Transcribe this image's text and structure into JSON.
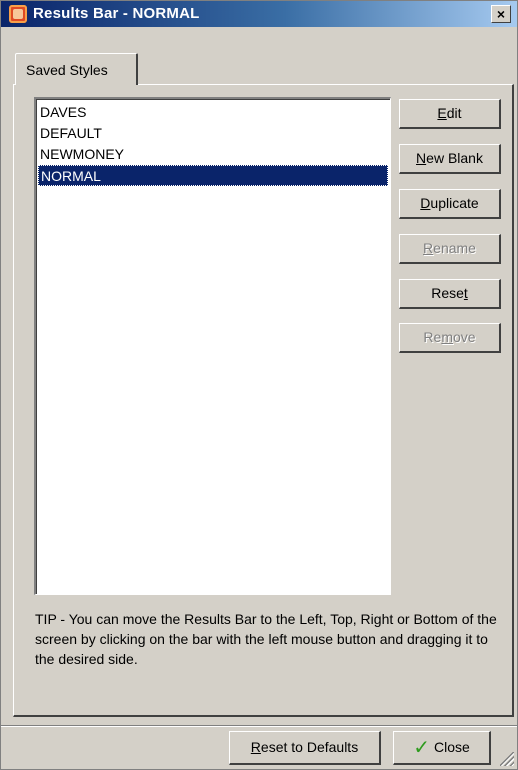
{
  "window": {
    "title": "Results Bar - NORMAL",
    "close_symbol": "×"
  },
  "tabs": [
    {
      "label": "Saved Styles",
      "active": true
    }
  ],
  "styles_list": {
    "items": [
      "DAVES",
      "DEFAULT",
      "NEWMONEY",
      "NORMAL"
    ],
    "selected": "NORMAL"
  },
  "buttons": {
    "edit": {
      "pre": "",
      "mnemonic": "E",
      "post": "dit",
      "enabled": true
    },
    "new_blank": {
      "pre": "",
      "mnemonic": "N",
      "post": "ew Blank",
      "enabled": true
    },
    "duplicate": {
      "pre": "",
      "mnemonic": "D",
      "post": "uplicate",
      "enabled": true
    },
    "rename": {
      "pre": "",
      "mnemonic": "R",
      "post": "ename",
      "enabled": false
    },
    "reset": {
      "pre": "Rese",
      "mnemonic": "t",
      "post": "",
      "enabled": true
    },
    "remove": {
      "pre": "Re",
      "mnemonic": "m",
      "post": "ove",
      "enabled": false
    }
  },
  "tip": "TIP - You can move the Results Bar to the Left, Top, Right or Bottom of the screen by clicking on the bar with the left mouse button and dragging it to the desired side.",
  "footer": {
    "reset_defaults": {
      "mnemonic": "R",
      "post": "eset to Defaults"
    },
    "close": {
      "label": "Close",
      "icon": "check-icon"
    }
  },
  "colors": {
    "selection": "#0a246a",
    "face": "#d4d0c8",
    "check": "#2e9b1e"
  }
}
